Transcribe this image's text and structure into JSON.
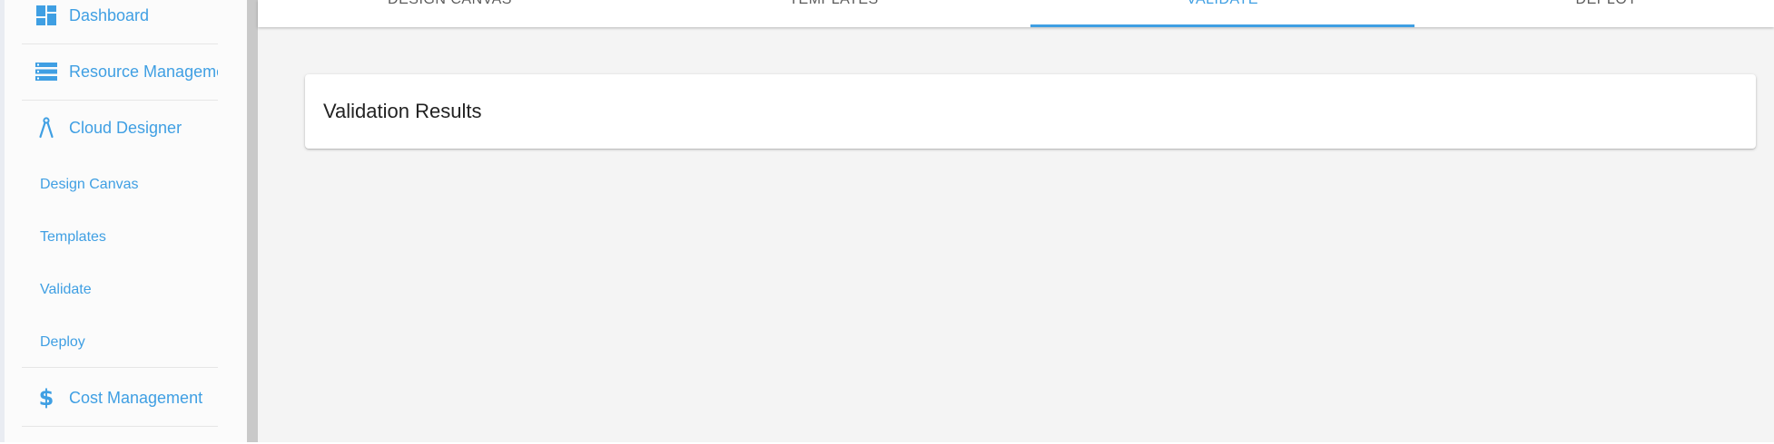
{
  "sidebar": {
    "nav_items": [
      {
        "label": "Dashboard",
        "icon": "dashboard-icon"
      },
      {
        "label": "Resource Management",
        "icon": "list-icon"
      },
      {
        "label": "Cloud Designer",
        "icon": "compass-icon"
      },
      {
        "label": "Cost Management",
        "icon": "dollar-icon"
      }
    ],
    "sub_items": [
      {
        "label": "Design Canvas"
      },
      {
        "label": "Templates"
      },
      {
        "label": "Validate"
      },
      {
        "label": "Deploy"
      }
    ]
  },
  "tabs": [
    {
      "label": "DESIGN CANVAS",
      "active": false
    },
    {
      "label": "TEMPLATES",
      "active": false
    },
    {
      "label": "VALIDATE",
      "active": true
    },
    {
      "label": "DEPLOY",
      "active": false
    }
  ],
  "card": {
    "title": "Validation Results"
  },
  "colors": {
    "accent": "#3f9fe3",
    "background": "#f4f4f4",
    "sidebar_bg": "#fbfbfb",
    "scrollbar": "#c9c9c9"
  }
}
